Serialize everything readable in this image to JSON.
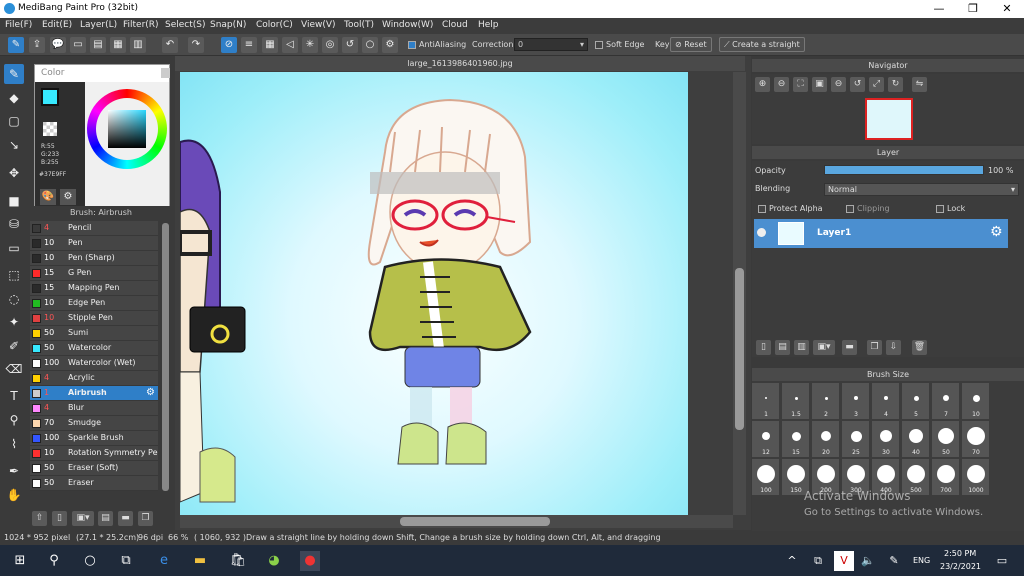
{
  "window": {
    "title": "MediBang Paint Pro (32bit)",
    "controls": [
      "—",
      "❐",
      "✕"
    ]
  },
  "menu": [
    "File(F)",
    "Edit(E)",
    "Layer(L)",
    "Filter(R)",
    "Select(S)",
    "Snap(N)",
    "Color(C)",
    "View(V)",
    "Tool(T)",
    "Window(W)",
    "Cloud",
    "Help"
  ],
  "toolbar": {
    "antialiasing_label": "AntiAliasing",
    "correction_label": "Correction",
    "correction_value": "0",
    "soft_edge_label": "Soft Edge",
    "key_label": "Key",
    "reset_label": "Reset",
    "straight_label": "Create a straight"
  },
  "color_panel": {
    "title": "Color",
    "r": "R:55",
    "g": "G:233",
    "b": "B:255",
    "hex": "#37E9FF",
    "fg_color": "#37e9ff"
  },
  "brush_panel": {
    "title": "Brush: Airbrush",
    "items": [
      {
        "size": "4",
        "name": "Pencil",
        "color": "#3a3a3a",
        "size_color": "#ff5555"
      },
      {
        "size": "10",
        "name": "Pen",
        "color": "#2a2a2a",
        "size_color": "#ffffff"
      },
      {
        "size": "10",
        "name": "Pen (Sharp)",
        "color": "#2a2a2a",
        "size_color": "#ffffff"
      },
      {
        "size": "15",
        "name": "G Pen",
        "color": "#ff2a2a",
        "size_color": "#ffffff"
      },
      {
        "size": "15",
        "name": "Mapping Pen",
        "color": "#2a2a2a",
        "size_color": "#ffffff"
      },
      {
        "size": "10",
        "name": "Edge Pen",
        "color": "#22bb22",
        "size_color": "#ffffff"
      },
      {
        "size": "10",
        "name": "Stipple Pen",
        "color": "#e04040",
        "size_color": "#ff5555"
      },
      {
        "size": "50",
        "name": "Sumi",
        "color": "#ffd000",
        "size_color": "#ffffff"
      },
      {
        "size": "50",
        "name": "Watercolor",
        "color": "#37e9ff",
        "size_color": "#ffffff"
      },
      {
        "size": "100",
        "name": "Watercolor (Wet)",
        "color": "#ffffff",
        "size_color": "#ffffff"
      },
      {
        "size": "4",
        "name": "Acrylic",
        "color": "#ffd000",
        "size_color": "#ff5555"
      },
      {
        "size": "1",
        "name": "Airbrush",
        "color": "#cccccc",
        "size_color": "#ff5555"
      },
      {
        "size": "4",
        "name": "Blur",
        "color": "#ff88ff",
        "size_color": "#ff5555"
      },
      {
        "size": "70",
        "name": "Smudge",
        "color": "#ffd9b0",
        "size_color": "#ffffff"
      },
      {
        "size": "100",
        "name": "Sparkle Brush",
        "color": "#3355ff",
        "size_color": "#ffffff"
      },
      {
        "size": "10",
        "name": "Rotation Symmetry Pe",
        "color": "#ff3030",
        "size_color": "#ffffff"
      },
      {
        "size": "50",
        "name": "Eraser (Soft)",
        "color": "#ffffff",
        "size_color": "#ffffff"
      },
      {
        "size": "50",
        "name": "Eraser",
        "color": "#ffffff",
        "size_color": "#ffffff"
      }
    ],
    "selected_index": 11
  },
  "canvas": {
    "doc_name": "large_1613986401960.jpg"
  },
  "navigator": {
    "title": "Navigator"
  },
  "layer_panel": {
    "title": "Layer",
    "opacity_label": "Opacity",
    "opacity_value": "100 %",
    "blending_label": "Blending",
    "blending_value": "Normal",
    "protect_alpha": "Protect Alpha",
    "clipping": "Clipping",
    "lock": "Lock",
    "layer_name": "Layer1"
  },
  "brush_size": {
    "title": "Brush Size",
    "sizes": [
      "1",
      "1.5",
      "2",
      "3",
      "4",
      "5",
      "7",
      "10",
      "12",
      "15",
      "20",
      "25",
      "30",
      "40",
      "50",
      "70",
      "100",
      "150",
      "200",
      "300",
      "400",
      "500",
      "700",
      "1000"
    ]
  },
  "statusbar": {
    "dims": "1024 * 952 pixel",
    "cm": "(27.1 * 25.2cm)",
    "dpi": "96 dpi",
    "zoom": "66 %",
    "coords": "( 1060, 932 )",
    "hint": "Draw a straight line by holding down Shift, Change a brush size by holding down Ctrl, Alt, and dragging"
  },
  "watermark": {
    "line1": "Activate Windows",
    "line2": "Go to Settings to activate Windows."
  },
  "taskbar": {
    "lang": "ENG",
    "time": "2:50 PM",
    "date": "23/2/2021"
  }
}
